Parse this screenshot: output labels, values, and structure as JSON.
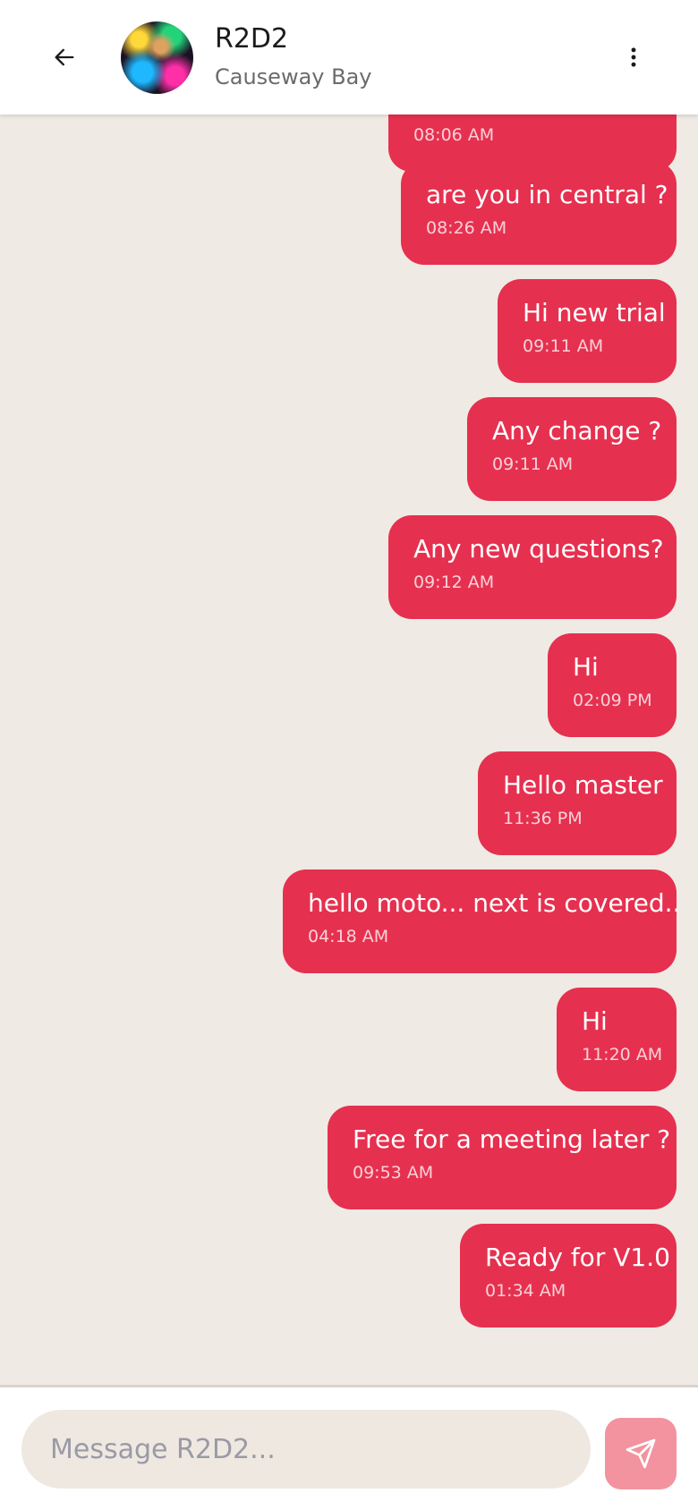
{
  "header": {
    "name": "R2D2",
    "subtitle": "Causeway Bay",
    "partial_top_time": "08:06 AM"
  },
  "messages": [
    {
      "text": "are you in central ?",
      "time": "08:26 AM"
    },
    {
      "text": "Hi new trial",
      "time": "09:11 AM"
    },
    {
      "text": "Any change ?",
      "time": "09:11 AM"
    },
    {
      "text": "Any new questions?",
      "time": "09:12 AM"
    },
    {
      "text": "Hi",
      "time": "02:09 PM"
    },
    {
      "text": "Hello master",
      "time": "11:36 PM"
    },
    {
      "text": "hello moto... next is covered..",
      "time": "04:18 AM"
    },
    {
      "text": "Hi",
      "time": "11:20 AM"
    },
    {
      "text": "Free for a meeting later ?",
      "time": "09:53 AM"
    },
    {
      "text": "Ready for V1.0",
      "time": "01:34 AM"
    }
  ],
  "composer": {
    "placeholder": "Message R2D2..."
  },
  "colors": {
    "bubble": "#e6304f",
    "send_button": "#f2939f",
    "background": "#efeae4"
  },
  "icons": {
    "back": "arrow-left-icon",
    "menu": "more-vert-icon",
    "send": "send-icon"
  }
}
